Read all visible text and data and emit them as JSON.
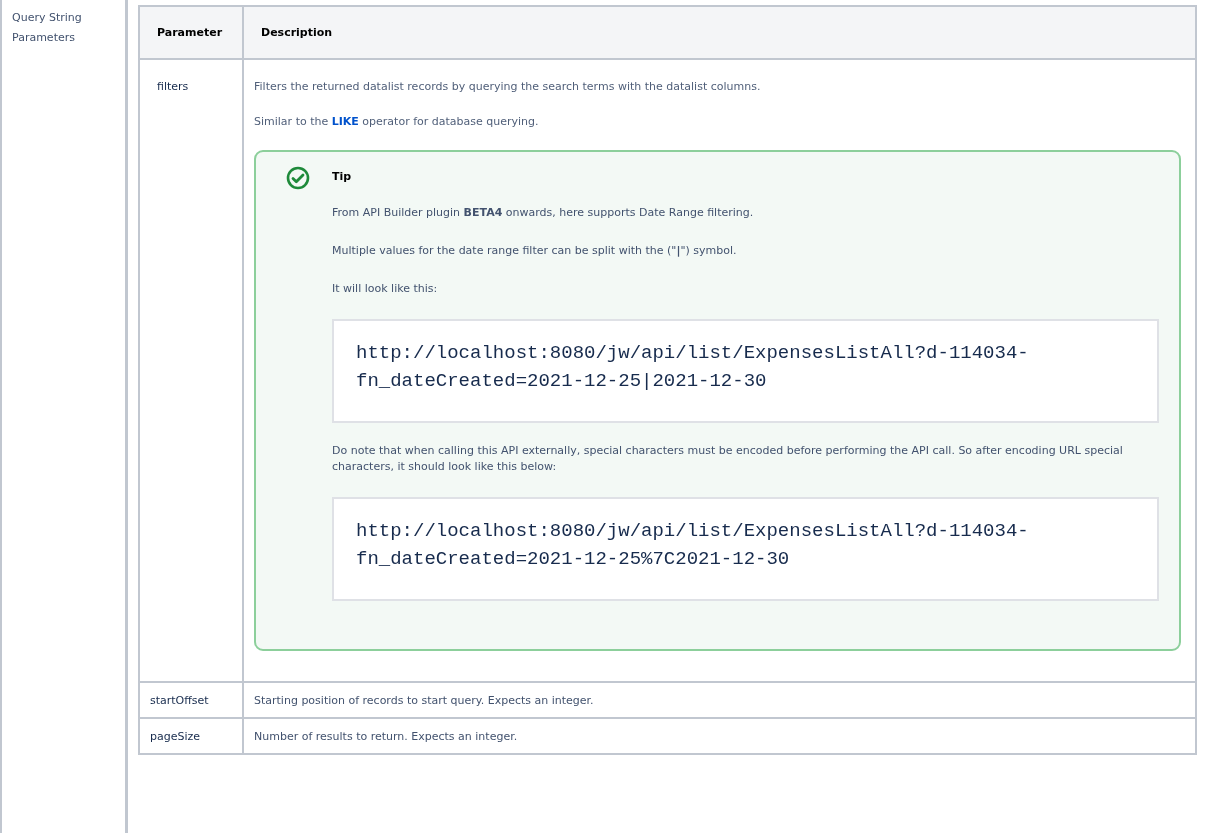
{
  "section_label": "Query String Parameters",
  "table": {
    "columns": [
      "Parameter",
      "Description"
    ],
    "rows": [
      {
        "kind": "tip",
        "parameter": "filters",
        "description": "Filters the returned datalist records by querying the search terms with the datalist columns.",
        "similar_before": "Similar to the ",
        "similar_link": "LIKE",
        "similar_after": " operator for database querying.",
        "tip": {
          "title": "Tip",
          "paragraphs": [
            "From API Builder plugin **BETA4** onwards, here supports Date Range filtering.",
            "Multiple values for the date range filter can be split with the (\"**|**\") symbol.",
            "It will look like this:"
          ],
          "code_1": "http://localhost:8080/jw/api/list/ExpensesListAll?d-114034-fn_dateCreated=2021-12-25|2021-12-30",
          "note": "Do note that when calling this API externally, special characters must be encoded before performing the API call. So after encoding URL special characters, it should look like this below:",
          "code_2": "http://localhost:8080/jw/api/list/ExpensesListAll?d-114034-fn_dateCreated=2021-12-25%7C2021-12-30"
        }
      },
      {
        "kind": "plain",
        "parameter": "startOffset",
        "description": "Starting position of records to start query. Expects an integer."
      },
      {
        "kind": "plain",
        "parameter": "pageSize",
        "description": "Number of results to return. Expects an integer."
      }
    ]
  }
}
